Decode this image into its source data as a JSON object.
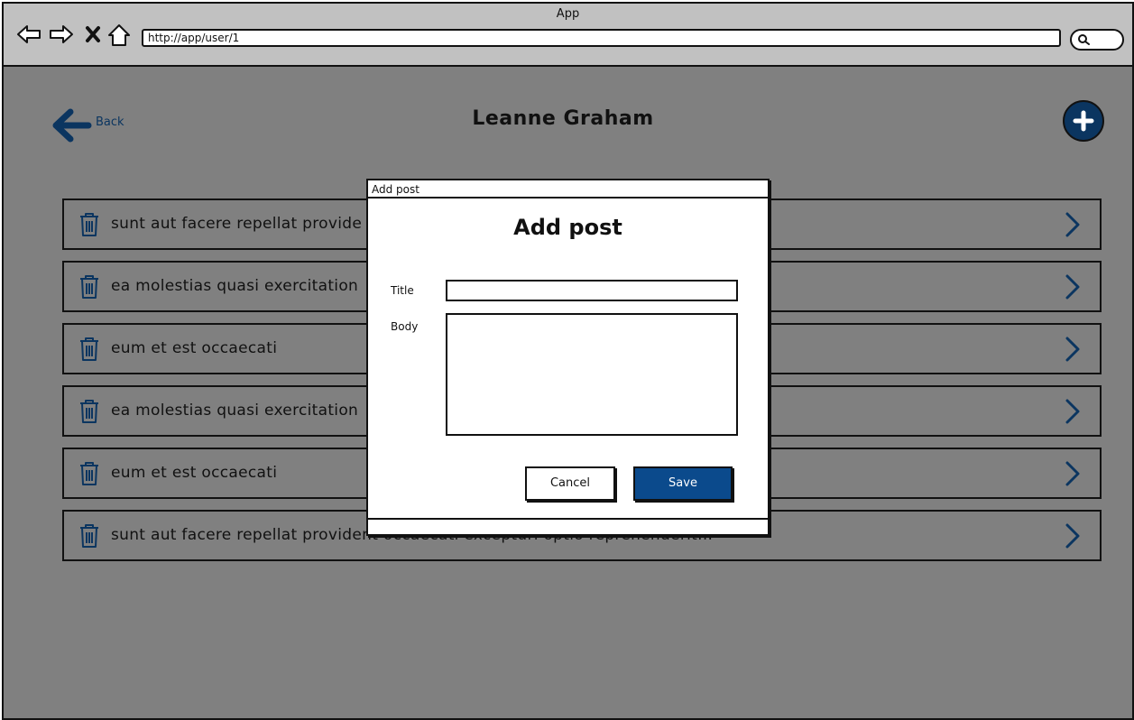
{
  "browser": {
    "title": "App",
    "url": "http://app/user/1"
  },
  "header": {
    "back_label": "Back",
    "user_name": "Leanne Graham"
  },
  "posts": [
    {
      "title": "sunt aut facere repellat provide"
    },
    {
      "title": "ea molestias quasi exercitation"
    },
    {
      "title": "eum et est occaecati"
    },
    {
      "title": "ea molestias quasi exercitation"
    },
    {
      "title": "eum et est occaecati"
    },
    {
      "title": "sunt aut facere repellat provident occaecati excepturi optio reprehenderit..."
    }
  ],
  "modal": {
    "window_title": "Add post",
    "heading": "Add post",
    "title_label": "Title",
    "title_value": "",
    "body_label": "Body",
    "body_value": "",
    "cancel_label": "Cancel",
    "save_label": "Save"
  },
  "colors": {
    "overlay": "#808080",
    "accent": "#0b4a8c",
    "icon_navy": "#0b3560",
    "chrome": "#c1c1c1"
  }
}
